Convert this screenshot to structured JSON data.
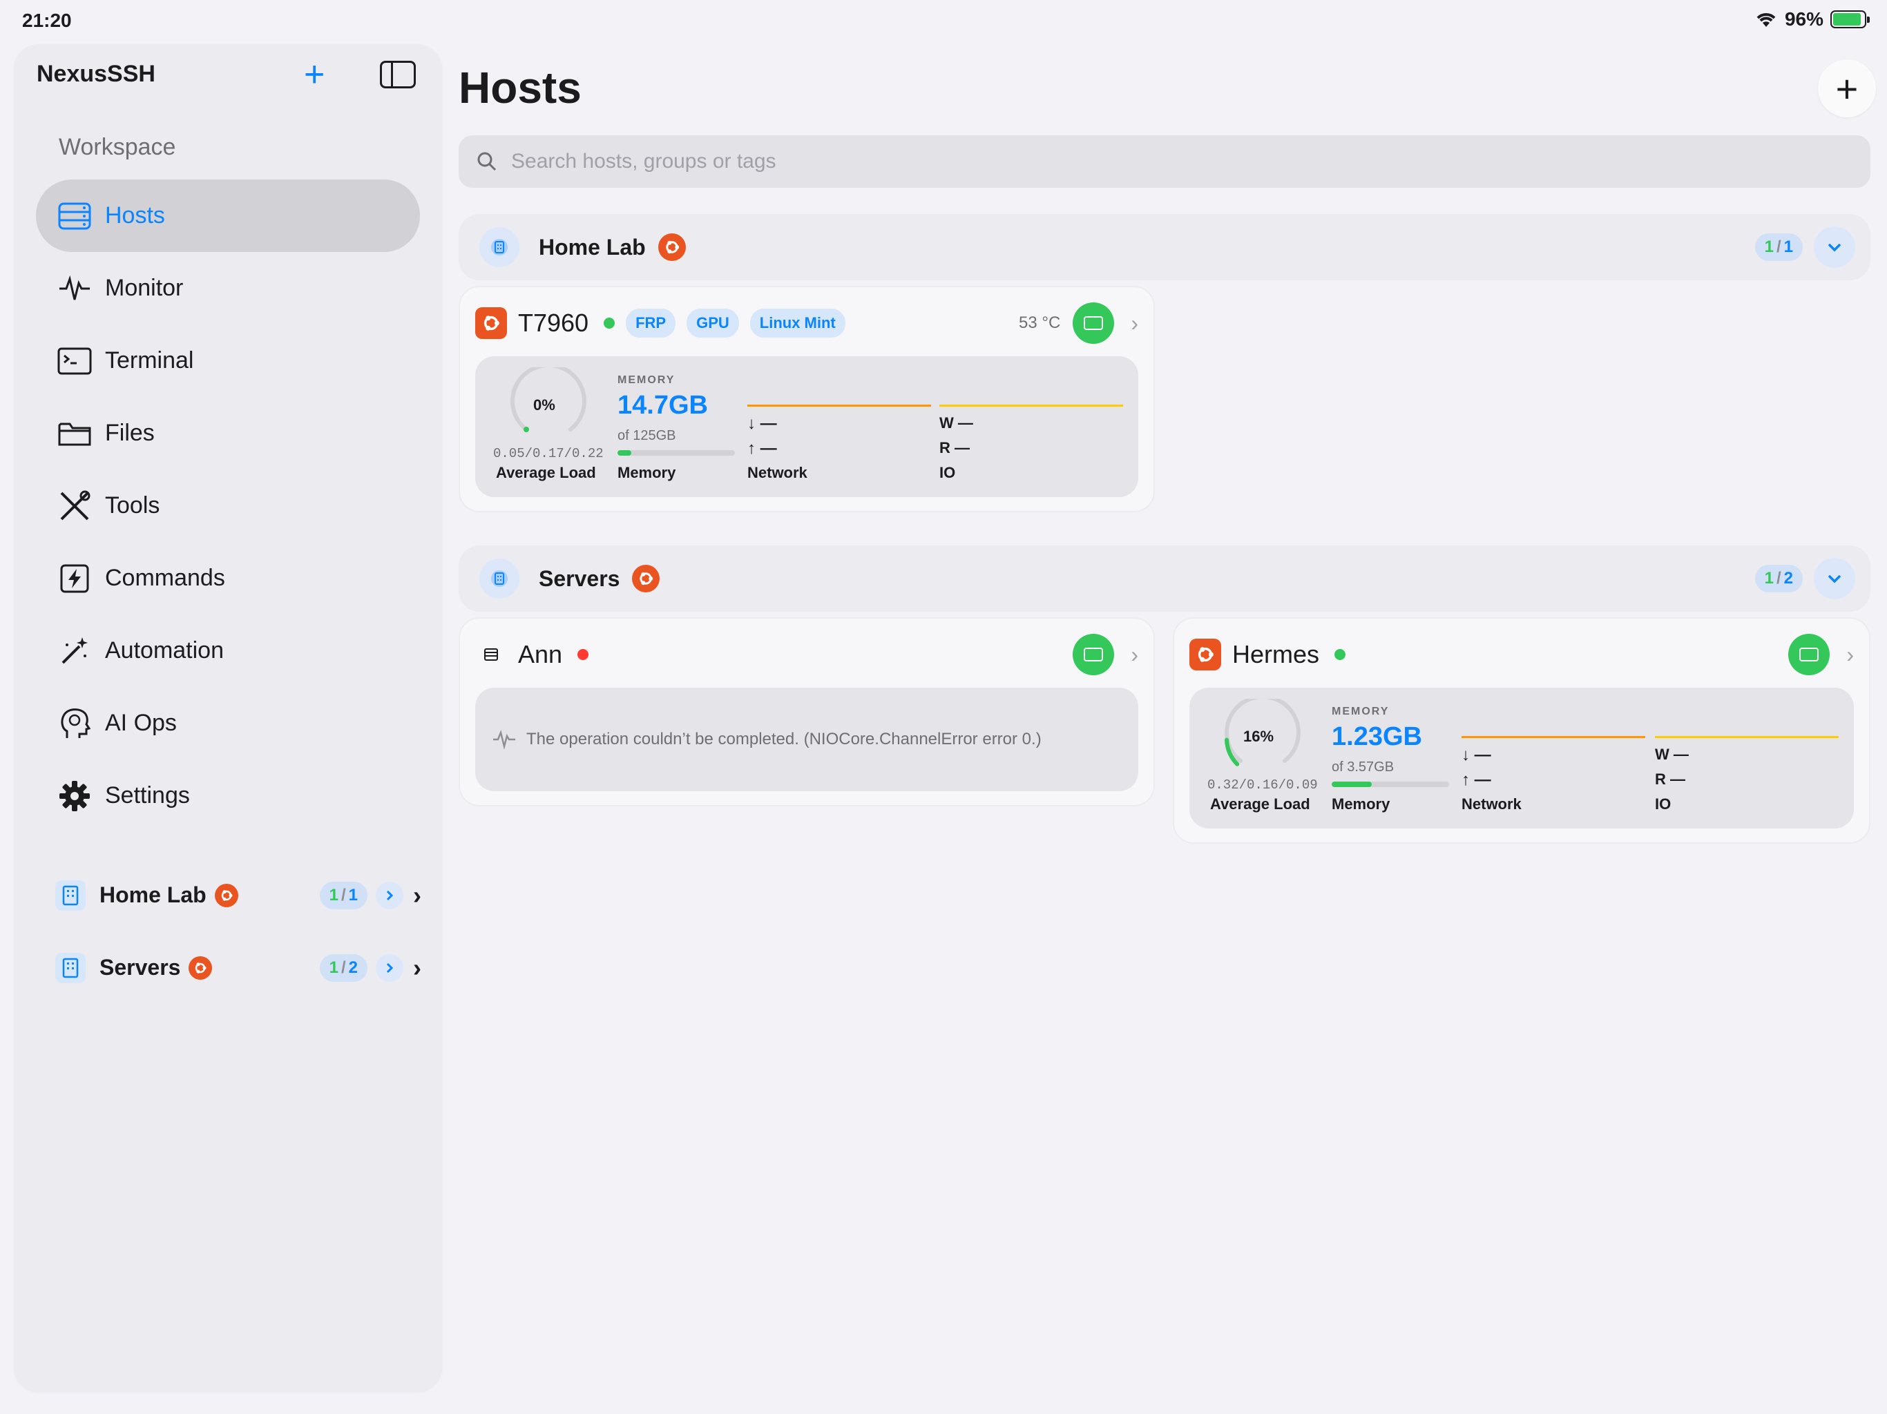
{
  "status": {
    "time": "21:20",
    "battery": "96%"
  },
  "sidebar": {
    "app_title": "NexusSSH",
    "section": "Workspace",
    "items": [
      {
        "label": "Hosts",
        "icon": "server-icon",
        "active": true
      },
      {
        "label": "Monitor",
        "icon": "waveform-icon"
      },
      {
        "label": "Terminal",
        "icon": "terminal-icon"
      },
      {
        "label": "Files",
        "icon": "folder-icon"
      },
      {
        "label": "Tools",
        "icon": "tools-icon"
      },
      {
        "label": "Commands",
        "icon": "bolt-icon"
      },
      {
        "label": "Automation",
        "icon": "magic-wand-icon"
      },
      {
        "label": "AI Ops",
        "icon": "brain-head-icon"
      },
      {
        "label": "Settings",
        "icon": "gear-icon"
      }
    ],
    "groups": [
      {
        "name": "Home Lab",
        "online": "1",
        "total": "1"
      },
      {
        "name": "Servers",
        "online": "1",
        "total": "2"
      }
    ]
  },
  "main": {
    "title": "Hosts",
    "search_placeholder": "Search hosts, groups or tags",
    "groups": [
      {
        "name": "Home Lab",
        "online": "1",
        "total": "1"
      },
      {
        "name": "Servers",
        "online": "1",
        "total": "2"
      }
    ],
    "hosts": {
      "t7960": {
        "name": "T7960",
        "status": "online",
        "tags": [
          "FRP",
          "GPU",
          "Linux Mint"
        ],
        "temperature": "53 °C",
        "cpu_percent": "0%",
        "cpu_fraction": 0.0,
        "load": "0.05/0.17/0.22",
        "memory_caption": "MEMORY",
        "memory_used": "14.7GB",
        "memory_total": "of 125GB",
        "memory_fraction": 0.12,
        "net_down": "—",
        "net_up": "—",
        "io_w": "—",
        "io_r": "—"
      },
      "ann": {
        "name": "Ann",
        "status": "offline",
        "error": "The operation couldn’t be completed. (NIOCore.ChannelError error 0.)"
      },
      "hermes": {
        "name": "Hermes",
        "status": "online",
        "cpu_percent": "16%",
        "cpu_fraction": 0.16,
        "load": "0.32/0.16/0.09",
        "memory_caption": "MEMORY",
        "memory_used": "1.23GB",
        "memory_total": "of 3.57GB",
        "memory_fraction": 0.34,
        "net_down": "—",
        "net_up": "—",
        "io_w": "—",
        "io_r": "—"
      }
    },
    "labels": {
      "avg_load": "Average Load",
      "memory": "Memory",
      "network": "Network",
      "io": "IO",
      "w": "W",
      "r": "R"
    }
  },
  "colors": {
    "accent": "#0a84ff",
    "online": "#34c759",
    "offline": "#ff3b30",
    "ubuntu": "#e95420",
    "network_line": "#ff9500",
    "io_line": "#ffcc00"
  }
}
